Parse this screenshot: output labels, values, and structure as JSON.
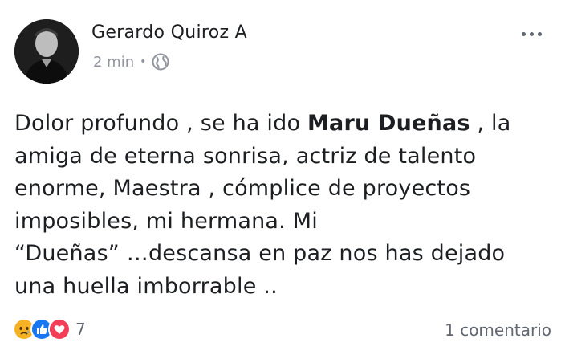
{
  "post": {
    "author": "Gerardo Quiroz A",
    "timestamp": "2 min",
    "separator": "•",
    "privacy_icon": "globe-icon",
    "more_icon": "more-options-icon",
    "text_lines": [
      {
        "before": "Dolor profundo , se ha ido ",
        "bold": "Maru Dueñas",
        "after": " , la"
      },
      {
        "before": "amiga de eterna sonrisa, actriz de talento",
        "bold": "",
        "after": ""
      },
      {
        "before": "enorme,  Maestra ,  cómplice de proyectos",
        "bold": "",
        "after": ""
      },
      {
        "before": "imposibles, mi hermana.  Mi",
        "bold": "",
        "after": ""
      },
      {
        "before": "“Dueñas” …descansa en paz nos has dejado",
        "bold": "",
        "after": ""
      },
      {
        "before": "una huella imborrable ..",
        "bold": "",
        "after": ""
      }
    ]
  },
  "footer": {
    "reaction_icons": [
      "sad-reaction-icon",
      "like-reaction-icon",
      "love-reaction-icon"
    ],
    "reaction_count": "7",
    "comments_label": "1 comentario"
  },
  "colors": {
    "text": "#1c1e21",
    "meta": "#90949c",
    "like": "#1877f2",
    "love": "#f33e58",
    "sad": "#f7b125"
  }
}
